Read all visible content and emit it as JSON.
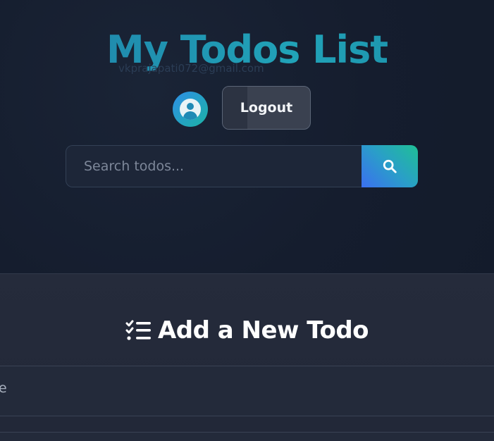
{
  "header": {
    "title": "My Todos List",
    "email": "vkprajapati072@gmail.com",
    "logout_label": "Logout"
  },
  "search": {
    "placeholder": "Search todos..."
  },
  "add_section": {
    "heading": "Add a New Todo",
    "partial_field_text": "e"
  },
  "colors": {
    "title_gradient": [
      "#1f7fa8",
      "#21a3b8"
    ],
    "search_button_gradient": [
      "#3b6ff0",
      "#1fc095"
    ],
    "avatar_gradient": [
      "#2e8ee6",
      "#1cb3a5"
    ]
  },
  "icons": {
    "avatar": "user-circle-icon",
    "search": "search-icon",
    "heading": "list-check-icon"
  }
}
